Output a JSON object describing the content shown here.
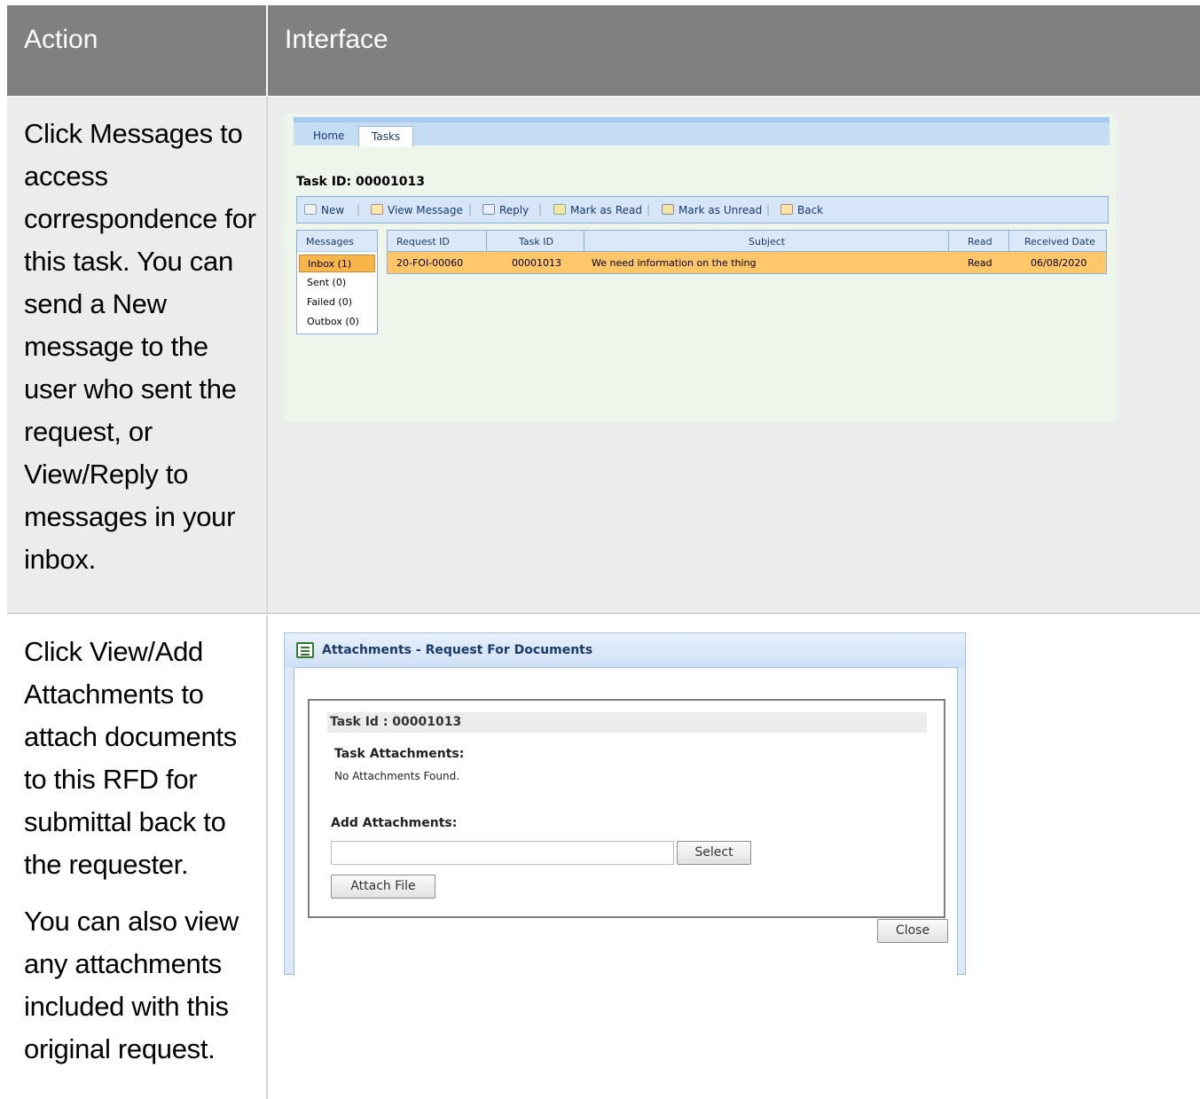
{
  "table": {
    "headers": {
      "action": "Action",
      "interface": "Interface"
    },
    "rows": [
      {
        "action_text": "Click Messages to access correspondence for this task. You can send a New message to the user who sent the request, or View/Reply to messages in your inbox."
      },
      {
        "action_text": "Click View/Add Attachments to attach documents to this RFD for submittal back to the requester.",
        "action_text_2": "You can also view any attachments included with this original request."
      }
    ]
  },
  "tasks_screen": {
    "tabs": [
      "Home",
      "Tasks"
    ],
    "task_id_label": "Task ID: 00001013",
    "toolbar": [
      "New",
      "View Message",
      "Reply",
      "Mark as Read",
      "Mark as Unread",
      "Back"
    ],
    "nav": {
      "header": "Messages",
      "items": [
        "Inbox (1)",
        "Sent (0)",
        "Failed (0)",
        "Outbox (0)"
      ]
    },
    "grid": {
      "columns": [
        "Request ID",
        "Task ID",
        "Subject",
        "Read",
        "Received Date"
      ],
      "rows": [
        [
          "20-FOI-00060",
          "00001013",
          "We need information on the thing",
          "Read",
          "06/08/2020"
        ]
      ]
    },
    "colors": {
      "selected_row": "#ffc76a",
      "toolbar_bg": "#d6e6f8"
    }
  },
  "attachments_dialog": {
    "title": "Attachments - Request For Documents",
    "task_id": "Task Id : 00001013",
    "task_attachments_label": "Task Attachments:",
    "no_attachments": "No Attachments Found.",
    "add_attachments_label": "Add Attachments:",
    "select_label": "Select",
    "attach_file_label": "Attach File",
    "close_label": "Close"
  }
}
